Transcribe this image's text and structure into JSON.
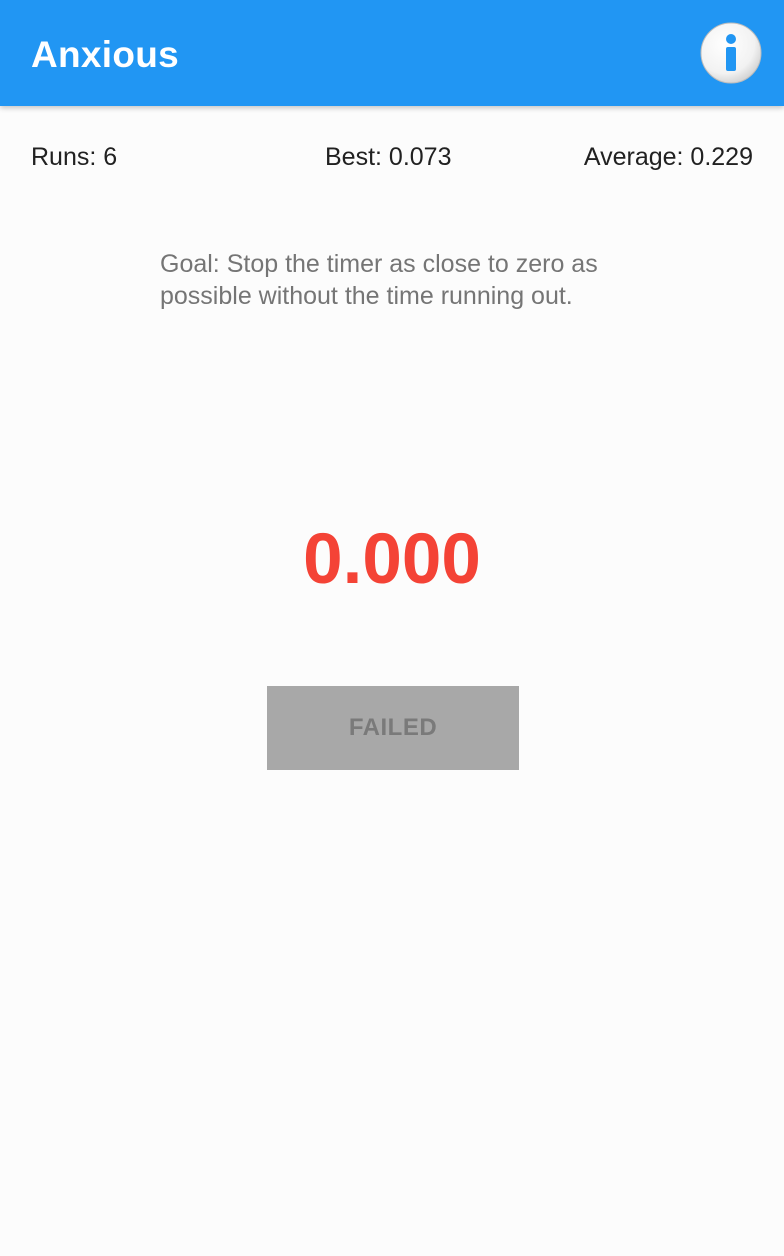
{
  "app": {
    "title": "Anxious",
    "theme_color": "#2196f3",
    "info_icon": "info-icon"
  },
  "stats": {
    "runs": "Runs: 6",
    "best": "Best: 0.073",
    "average": "Average: 0.229"
  },
  "goal": {
    "text": "Goal: Stop the timer as close to zero as possible without the time running out."
  },
  "timer": {
    "value": "0.000",
    "color": "#f44336"
  },
  "action_button": {
    "label": "FAILED",
    "state": "disabled"
  }
}
